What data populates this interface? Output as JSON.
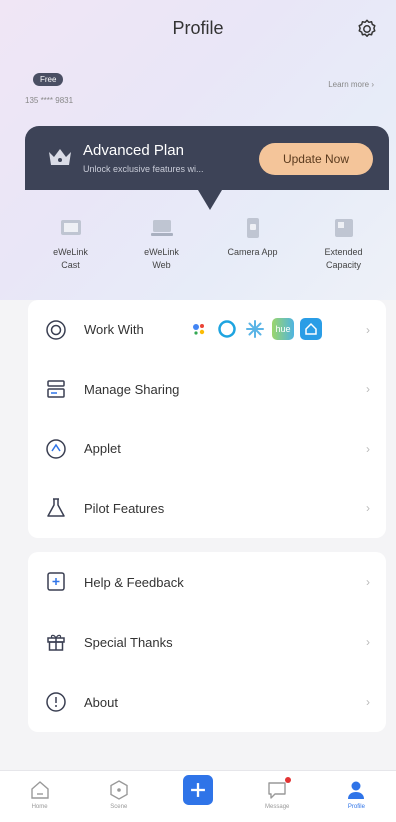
{
  "header": {
    "title": "Profile"
  },
  "account": {
    "plan_badge": "Free",
    "id_masked": "135 **** 9831",
    "learn_more": "Learn more"
  },
  "plan_card": {
    "name": "Advanced Plan",
    "description": "Unlock exclusive features wi...",
    "button": "Update Now"
  },
  "quick_actions": [
    {
      "label": "eWeLink\nCast",
      "icon": "cast-icon"
    },
    {
      "label": "eWeLink\nWeb",
      "icon": "web-icon"
    },
    {
      "label": "Camera App",
      "icon": "camera-app-icon"
    },
    {
      "label": "Extended\nCapacity",
      "icon": "capacity-icon"
    }
  ],
  "menu_primary": [
    {
      "label": "Work With",
      "icon": "work-with-icon"
    },
    {
      "label": "Manage Sharing",
      "icon": "sharing-icon"
    },
    {
      "label": "Applet",
      "icon": "applet-icon"
    },
    {
      "label": "Pilot Features",
      "icon": "flask-icon"
    }
  ],
  "work_with_icons": [
    "google-assistant-icon",
    "alexa-icon",
    "smartthings-icon",
    "hue-icon",
    "homekit-icon"
  ],
  "work_with_hue_text": "hue",
  "menu_secondary": [
    {
      "label": "Help & Feedback",
      "icon": "help-icon"
    },
    {
      "label": "Special Thanks",
      "icon": "gift-icon"
    },
    {
      "label": "About",
      "icon": "info-icon"
    }
  ],
  "tabbar": [
    {
      "label": "Home",
      "icon": "home-icon"
    },
    {
      "label": "Scene",
      "icon": "scene-icon"
    },
    {
      "label": "",
      "icon": "add-icon"
    },
    {
      "label": "Message",
      "icon": "message-icon"
    },
    {
      "label": "Profile",
      "icon": "profile-icon"
    }
  ],
  "colors": {
    "accent": "#2f74e8",
    "plan_card_bg": "#3d4357",
    "update_button": "#f4c59a",
    "notification_dot": "#e23434"
  }
}
